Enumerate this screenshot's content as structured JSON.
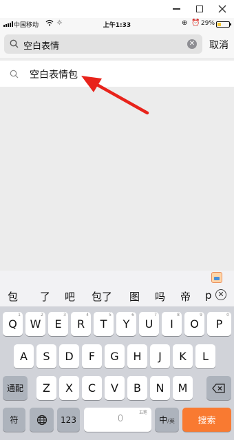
{
  "status_bar": {
    "carrier": "中国移动",
    "time": "上午1:33",
    "battery": "29%",
    "battery_level": 0.29
  },
  "search": {
    "query": "空白表情",
    "cancel_label": "取消"
  },
  "suggestion": {
    "label": "空白表情包"
  },
  "keyboard": {
    "candidates": [
      "包",
      "了",
      "吧",
      "包了",
      "图",
      "吗",
      "帝",
      "p"
    ],
    "row1": [
      "Q",
      "W",
      "E",
      "R",
      "T",
      "Y",
      "U",
      "I",
      "O",
      "P"
    ],
    "row1_alt": [
      "1",
      "2",
      "3",
      "4",
      "5",
      "6",
      "7",
      "8",
      "9",
      "0"
    ],
    "row2": [
      "A",
      "S",
      "D",
      "F",
      "G",
      "H",
      "J",
      "K",
      "L"
    ],
    "row3": [
      "Z",
      "X",
      "C",
      "V",
      "B",
      "N",
      "M"
    ],
    "tongpei": "通配",
    "symbol": "符",
    "num": "123",
    "space_hint": "五笔",
    "lang": "中",
    "lang_sub": "/英",
    "search": "搜索"
  },
  "colors": {
    "search_key": "#f97a31",
    "arrow": "#e8231b"
  }
}
